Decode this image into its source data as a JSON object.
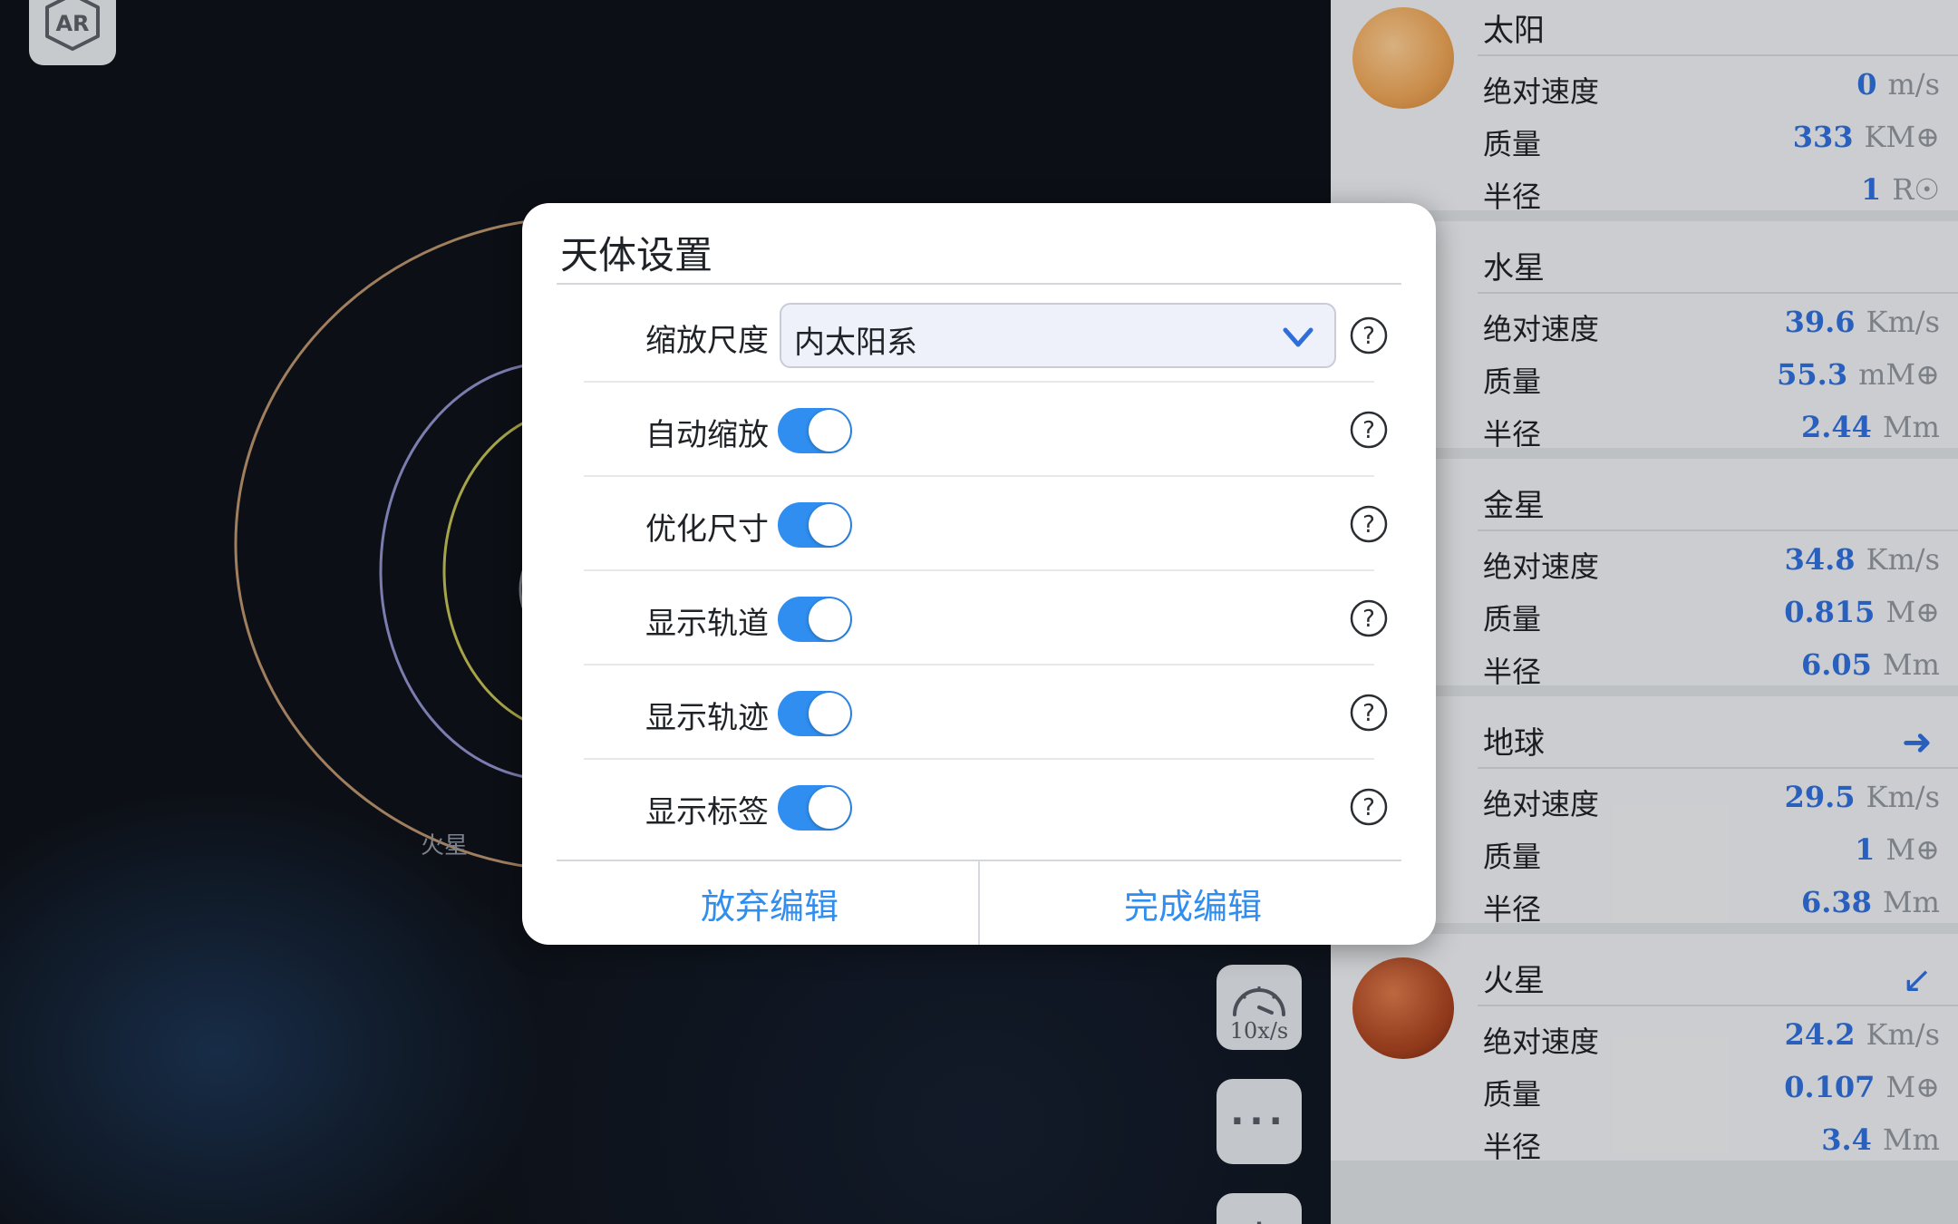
{
  "app": {
    "ar_label": "AR",
    "speed_label": "10x/s",
    "more_label": "···",
    "zoom_label": "+"
  },
  "space_view": {
    "orbit_colors": [
      "#b7916b",
      "#8d8fc7",
      "#bdbb52",
      "#8a8f99"
    ],
    "planet_labels": [
      "火星"
    ]
  },
  "settings_dialog": {
    "title": "天体设置",
    "rows": [
      {
        "label": "缩放尺度",
        "control": "select",
        "value": "内太阳系"
      },
      {
        "label": "自动缩放",
        "control": "toggle",
        "on": true
      },
      {
        "label": "优化尺寸",
        "control": "toggle",
        "on": true
      },
      {
        "label": "显示轨道",
        "control": "toggle",
        "on": true
      },
      {
        "label": "显示轨迹",
        "control": "toggle",
        "on": true
      },
      {
        "label": "显示标签",
        "control": "toggle",
        "on": true
      }
    ],
    "help_icon": "question-circle-icon",
    "discard_label": "放弃编辑",
    "done_label": "完成编辑",
    "accent_color": "#2f8ef0"
  },
  "planet_list": {
    "row_labels": {
      "speed": "绝对速度",
      "mass": "质量",
      "radius": "半径"
    },
    "planets": [
      {
        "name": "太阳",
        "color": "#e9a35a",
        "arrow": "",
        "speed": "0",
        "speed_unit": "m/s",
        "mass": "333",
        "mass_unit": "KM⊕",
        "radius": "1",
        "radius_unit": "R☉"
      },
      {
        "name": "水星",
        "color": "#3a3d42",
        "arrow": "",
        "speed": "39.6",
        "speed_unit": "Km/s",
        "mass": "55.3",
        "mass_unit": "mM⊕",
        "radius": "2.44",
        "radius_unit": "Mm"
      },
      {
        "name": "金星",
        "color": "#b3652e",
        "arrow": "",
        "speed": "34.8",
        "speed_unit": "Km/s",
        "mass": "0.815",
        "mass_unit": "M⊕",
        "radius": "6.05",
        "radius_unit": "Mm"
      },
      {
        "name": "地球",
        "color": "#2c3a4f",
        "arrow": "➜",
        "speed": "29.5",
        "speed_unit": "Km/s",
        "mass": "1",
        "mass_unit": "M⊕",
        "radius": "6.38",
        "radius_unit": "Mm"
      },
      {
        "name": "火星",
        "color": "#b24a25",
        "arrow": "↙",
        "speed": "24.2",
        "speed_unit": "Km/s",
        "mass": "0.107",
        "mass_unit": "M⊕",
        "radius": "3.4",
        "radius_unit": "Mm"
      }
    ]
  }
}
